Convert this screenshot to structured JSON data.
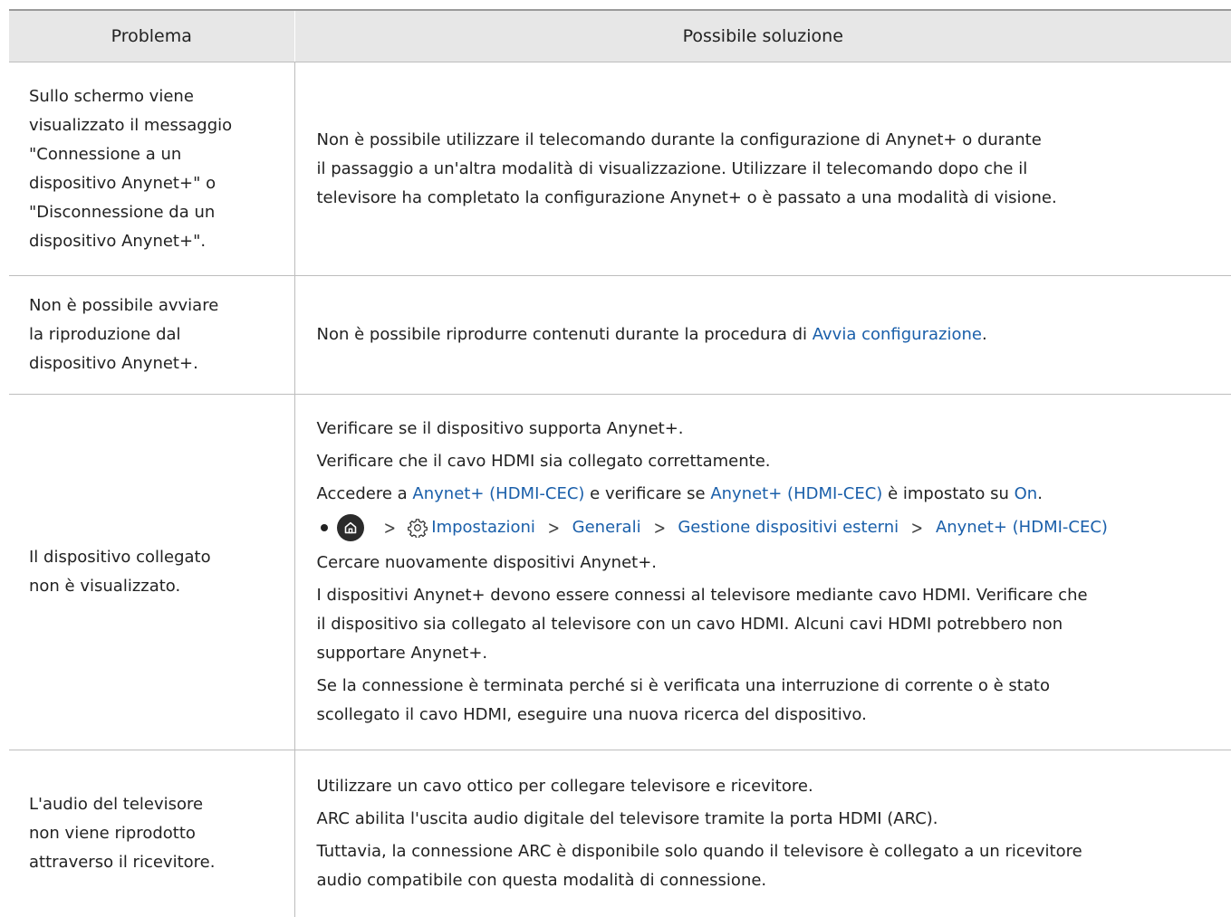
{
  "header": {
    "col1": "Problema",
    "col2": "Possibile soluzione"
  },
  "rows": [
    {
      "problem": [
        "Sullo schermo viene",
        "visualizzato il messaggio",
        "\"Connessione a un",
        "dispositivo Anynet+\" o",
        "\"Disconnessione da un",
        "dispositivo Anynet+\"."
      ],
      "solution": [
        "Non è possibile utilizzare il telecomando durante la configurazione di Anynet+ o durante",
        "il passaggio a un'altra modalità di visualizzazione. Utilizzare il telecomando dopo che il",
        "televisore ha completato la configurazione Anynet+ o è passato a una modalità di visione."
      ]
    },
    {
      "problem": [
        "Non è possibile avviare",
        "la riproduzione dal",
        "dispositivo Anynet+."
      ],
      "solution_prefix": "Non è possibile riprodurre contenuti durante la procedura di ",
      "solution_link": "Avvia configurazione",
      "solution_suffix": "."
    },
    {
      "problem": [
        "Il dispositivo collegato",
        "non è visualizzato."
      ],
      "p1": "Verificare se il dispositivo supporta Anynet+.",
      "p2": "Verificare che il cavo HDMI sia collegato correttamente.",
      "p3": {
        "a": "Accedere a ",
        "b": "Anynet+ (HDMI-CEC)",
        "c": " e verificare se ",
        "d": "Anynet+ (HDMI-CEC)",
        "e": " è impostato su ",
        "f": "On",
        "g": "."
      },
      "path": {
        "home_icon": "home-icon",
        "settings_icon": "gear-icon",
        "settings": "Impostazioni",
        "generali": "Generali",
        "gestione": "Gestione dispositivi esterni",
        "anynet": "Anynet+ (HDMI-CEC)"
      },
      "p4": "Cercare nuovamente dispositivi Anynet+.",
      "p5": [
        "I dispositivi Anynet+ devono essere connessi al televisore mediante cavo HDMI. Verificare che",
        "il dispositivo sia collegato al televisore con un cavo HDMI. Alcuni cavi HDMI potrebbero non",
        "supportare Anynet+."
      ],
      "p6": [
        "Se la connessione è terminata perché si è verificata una interruzione di corrente o è stato",
        "scollegato il cavo HDMI, eseguire una nuova ricerca del dispositivo."
      ]
    },
    {
      "problem": [
        "L'audio del televisore",
        "non viene riprodotto",
        "attraverso il ricevitore."
      ],
      "p1": "Utilizzare un cavo ottico per collegare televisore e ricevitore.",
      "p2": "ARC abilita l'uscita audio digitale del televisore tramite la porta HDMI (ARC).",
      "p3": [
        "Tuttavia, la connessione ARC è disponibile solo quando il televisore è collegato a un ricevitore",
        "audio compatibile con questa modalità di connessione."
      ]
    }
  ],
  "colors": {
    "link": "#1a5faa",
    "header_bg": "#e7e7e7",
    "border": "#bdbdbd"
  }
}
